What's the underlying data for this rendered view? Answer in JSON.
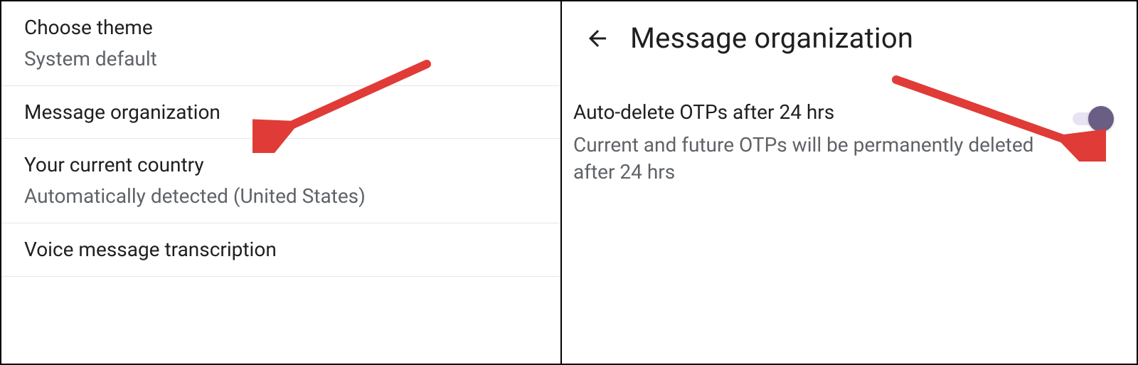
{
  "left_panel": {
    "items": [
      {
        "title": "Choose theme",
        "subtitle": "System default"
      },
      {
        "title": "Message organization",
        "subtitle": null
      },
      {
        "title": "Your current country",
        "subtitle": "Automatically detected (United States)"
      },
      {
        "title": "Voice message transcription",
        "subtitle": null
      }
    ]
  },
  "right_panel": {
    "page_title": "Message organization",
    "setting": {
      "title": "Auto-delete OTPs after 24 hrs",
      "subtitle": "Current and future OTPs will be permanently deleted after 24 hrs",
      "enabled": true
    }
  },
  "colors": {
    "arrow": "#e03b36",
    "toggle_knob": "#6a5e85",
    "toggle_track": "#e8e3f3"
  }
}
